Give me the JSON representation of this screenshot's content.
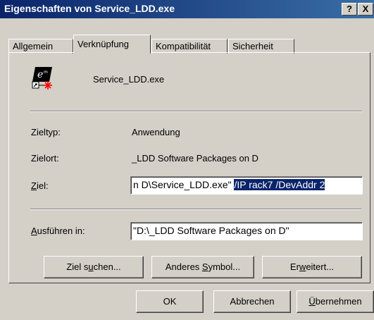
{
  "window": {
    "title": "Eigenschaften von Service_LDD.exe",
    "help_button": "?",
    "close_button": "X"
  },
  "tabs": [
    {
      "label": "Allgemein"
    },
    {
      "label": "Verknüpfung"
    },
    {
      "label": "Kompatibilität"
    },
    {
      "label": "Sicherheit"
    }
  ],
  "file": {
    "name": "Service_LDD.exe",
    "icon": "shortcut-exe-icon"
  },
  "fields": {
    "zieltyp_label": "Zieltyp:",
    "zieltyp_value": "Anwendung",
    "zielort_label": "Zielort:",
    "zielort_value": "_LDD Software Packages on D",
    "ziel_label_pre": "",
    "ziel_label_u": "Z",
    "ziel_label_post": "iel:",
    "ziel_value_plain": "n D\\Service_LDD.exe\" ",
    "ziel_value_selected": "/IP rack7 /DevAddr 2",
    "ausfuehren_label_u": "A",
    "ausfuehren_label_post": "usführen in:",
    "ausfuehren_value": "\"D:\\_LDD Software Packages on D\""
  },
  "buttons": {
    "ziel_suchen_pre": "Ziel s",
    "ziel_suchen_u": "u",
    "ziel_suchen_post": "chen...",
    "anderes_symbol_pre": "Anderes ",
    "anderes_symbol_u": "S",
    "anderes_symbol_post": "ymbol...",
    "erweitert_pre": "Er",
    "erweitert_u": "w",
    "erweitert_post": "eitert...",
    "ok": "OK",
    "abbrechen": "Abbrechen",
    "uebernehmen_u": "Ü",
    "uebernehmen_post": "bernehmen"
  }
}
